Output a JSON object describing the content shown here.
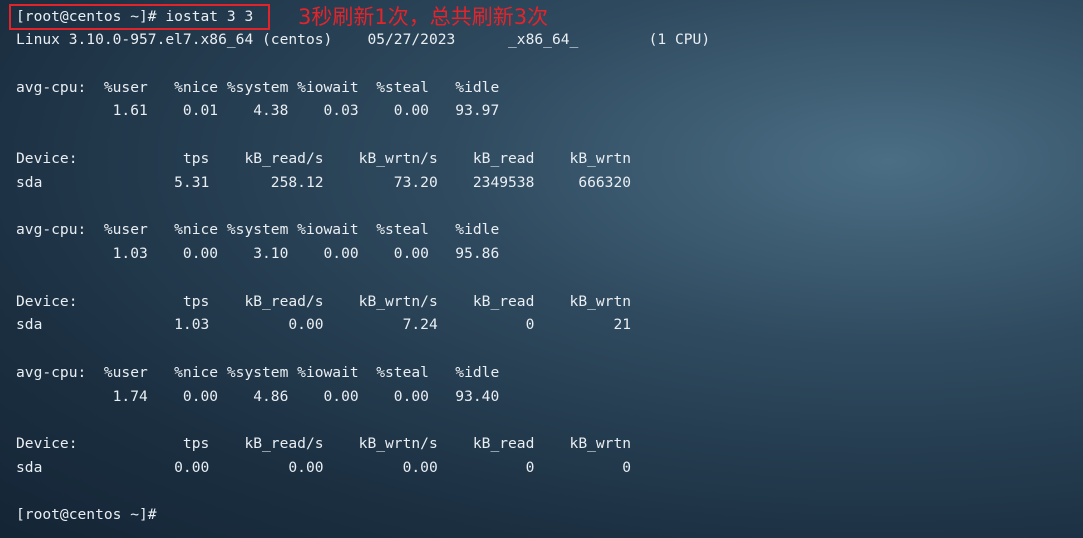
{
  "command_prompt": "[root@centos ~]# iostat 3 3",
  "annotation": "3秒刷新1次，总共刷新3次",
  "system_line": "Linux 3.10.0-957.el7.x86_64 (centos)    05/27/2023      _x86_64_        (1 CPU)",
  "reports": [
    {
      "cpu_header": "avg-cpu:  %user   %nice %system %iowait  %steal   %idle",
      "cpu_values": "           1.61    0.01    4.38    0.03    0.00   93.97",
      "device_header": "Device:            tps    kB_read/s    kB_wrtn/s    kB_read    kB_wrtn",
      "device_row": "sda               5.31       258.12        73.20    2349538     666320"
    },
    {
      "cpu_header": "avg-cpu:  %user   %nice %system %iowait  %steal   %idle",
      "cpu_values": "           1.03    0.00    3.10    0.00    0.00   95.86",
      "device_header": "Device:            tps    kB_read/s    kB_wrtn/s    kB_read    kB_wrtn",
      "device_row": "sda               1.03         0.00         7.24          0         21"
    },
    {
      "cpu_header": "avg-cpu:  %user   %nice %system %iowait  %steal   %idle",
      "cpu_values": "           1.74    0.00    4.86    0.00    0.00   93.40",
      "device_header": "Device:            tps    kB_read/s    kB_wrtn/s    kB_read    kB_wrtn",
      "device_row": "sda               0.00         0.00         0.00          0          0"
    }
  ],
  "final_prompt": "[root@centos ~]#",
  "colors": {
    "annotation": "#e3242b",
    "box_border": "#e0242a",
    "terminal_text": "#e9eef2"
  }
}
